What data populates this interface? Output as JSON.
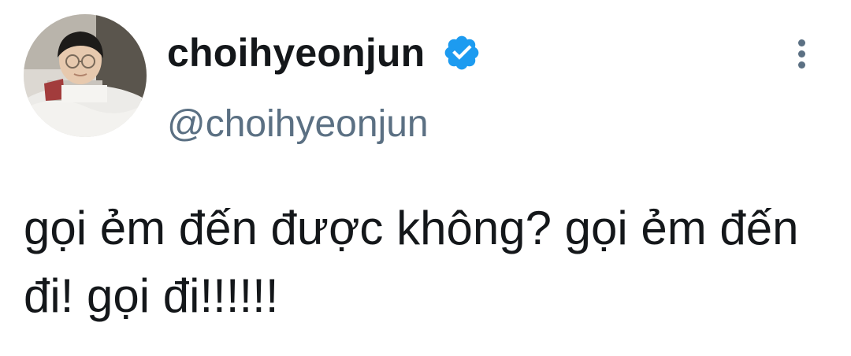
{
  "tweet": {
    "display_name": "choihyeonjun",
    "handle": "@choihyeonjun",
    "verified": true,
    "text": "gọi ẻm đến được không? gọi ẻm đến đi! gọi đi!!!!!!"
  },
  "icons": {
    "verified": "verified-badge-icon",
    "more": "more-vertical-icon"
  },
  "colors": {
    "text": "#14171a",
    "muted": "#5b7083",
    "verified_blue": "#1d9bf0",
    "background": "#ffffff"
  }
}
